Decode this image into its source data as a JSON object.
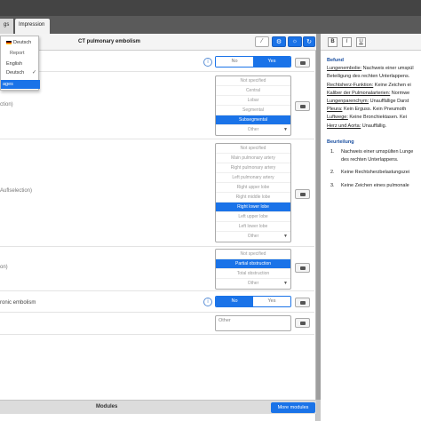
{
  "tabs": {
    "lang_tab_label": "gs",
    "impression_tab_label": "Impression"
  },
  "dropdown": {
    "current_language": "Deutsch",
    "header": "Report",
    "options": [
      "English",
      "Deutsch"
    ],
    "active_item": "ages"
  },
  "left_panel": {
    "title": "CT pulmonary embolism",
    "sections": [
      {
        "label": "",
        "options": [
          "No",
          "Yes"
        ],
        "selected": "Yes"
      },
      {
        "label": "ction)",
        "list": [
          "Not specified",
          "Central",
          "Lobar",
          "Segmental",
          "Subsegmental",
          "Other"
        ],
        "selected": "Subsegmental"
      },
      {
        "label": "Auflselection)",
        "list": [
          "Not specified",
          "Main pulmonary artery",
          "Right pulmonary artery",
          "Left pulmonary artery",
          "Right upper lobe",
          "Right middle lobe",
          "Right lower lobe",
          "Left upper lobe",
          "Left lower lobe",
          "Other"
        ],
        "selected": "Right lower lobe"
      },
      {
        "label": "on)",
        "list": [
          "Not specified",
          "Partial obstruction",
          "Total obstruction",
          "Other"
        ],
        "selected": "Partial obstruction"
      },
      {
        "label": "ronic embolism",
        "options": [
          "No",
          "Yes"
        ],
        "selected": "No"
      },
      {
        "label": "",
        "other_placeholder": "Other"
      }
    ],
    "bottom": {
      "modules_label": "Modules",
      "more_modules_label": "More modules"
    }
  },
  "report": {
    "format_buttons": [
      "B",
      "I",
      "U"
    ],
    "befund_heading": "Befund",
    "befund_lines": [
      {
        "u": "Lungenembolie:",
        "t": " Nachweis einer umspül"
      },
      {
        "u": "",
        "t": "Beteiligung des rechten Unterlappens."
      },
      {
        "u": "Rechtsherz-Funktion:",
        "t": " Keine Zeichen ei"
      },
      {
        "u": "Kaliber der Pulmonalarterien:",
        "t": " Normwe"
      },
      {
        "u": "Lungenparenchym:",
        "t": " Unauffällige Darst"
      },
      {
        "u": "Pleura:",
        "t": " Kein Erguss. Kein Pneumoth"
      },
      {
        "u": "Luftwege:",
        "t": " Keine Bronchiektasen. Kei"
      },
      {
        "u": "Herz und Aorta:",
        "t": " Unauffällig."
      }
    ],
    "beurteilung_heading": "Beurteilung",
    "beurteilung_items": [
      {
        "n": "1.",
        "lines": [
          "Nachweis einer umspülten Lunge",
          "des rechten Unterlappens."
        ]
      },
      {
        "n": "2.",
        "lines": [
          "Keine Rechtsherzbelastungszei"
        ]
      },
      {
        "n": "3.",
        "lines": [
          "Keine Zeichen eines pulmonale"
        ]
      }
    ]
  }
}
